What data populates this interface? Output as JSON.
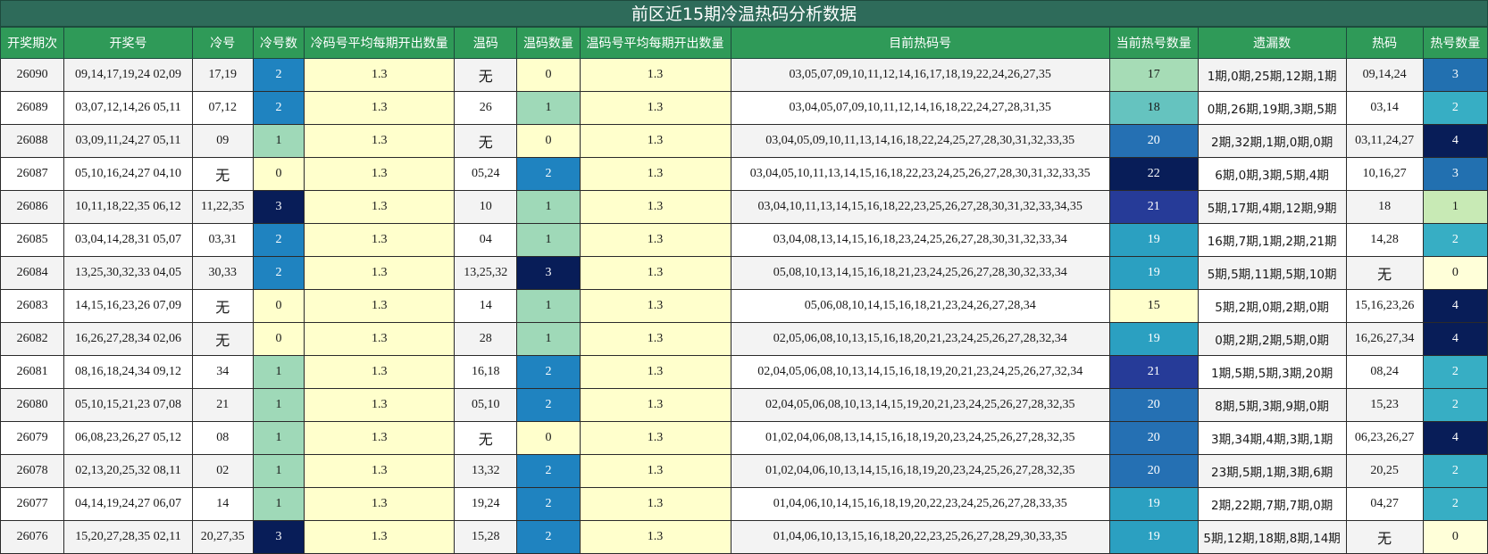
{
  "title": "前区近15期冷温热码分析数据",
  "headers": [
    "开奖期次",
    "开奖号",
    "冷号",
    "冷号数",
    "冷码号平均每期开出数量",
    "温码",
    "温码数量",
    "温码号平均每期开出数量",
    "目前热码号",
    "当前热号数量",
    "遗漏数",
    "热码",
    "热号数量"
  ],
  "colors": {
    "heatmap_0": "#ffffcc",
    "heatmap_1": "#9fd9b8",
    "heatmap_2": "#1f83c0",
    "heatmap_3": "#081d58",
    "hot_15": "#ffffcc",
    "hot_17": "#a6dcb6",
    "hot_18": "#65c3bf",
    "hot_19": "#2ba0c1",
    "hot_20": "#2570b3",
    "hot_21": "#263b98",
    "hot_22": "#081d58",
    "hotnum_0": "#ffffd9",
    "hotnum_1": "#c8eab5",
    "hotnum_2": "#37aec4",
    "hotnum_3": "#2270b0",
    "hotnum_4": "#081d58"
  },
  "rows": [
    {
      "period": "26090",
      "draw": "09,14,17,19,24 02,09",
      "cold": "17,19",
      "cold_count": "2",
      "cold_avg": "1.3",
      "warm": "无",
      "warm_count": "0",
      "warm_avg": "1.3",
      "hot_list": "03,05,07,09,10,11,12,14,16,17,18,19,22,24,26,27,35",
      "hot_count": "17",
      "miss": "1期,0期,25期,12期,1期",
      "hot": "09,14,24",
      "hot_num": "3"
    },
    {
      "period": "26089",
      "draw": "03,07,12,14,26 05,11",
      "cold": "07,12",
      "cold_count": "2",
      "cold_avg": "1.3",
      "warm": "26",
      "warm_count": "1",
      "warm_avg": "1.3",
      "hot_list": "03,04,05,07,09,10,11,12,14,16,18,22,24,27,28,31,35",
      "hot_count": "18",
      "miss": "0期,26期,19期,3期,5期",
      "hot": "03,14",
      "hot_num": "2"
    },
    {
      "period": "26088",
      "draw": "03,09,11,24,27 05,11",
      "cold": "09",
      "cold_count": "1",
      "cold_avg": "1.3",
      "warm": "无",
      "warm_count": "0",
      "warm_avg": "1.3",
      "hot_list": "03,04,05,09,10,11,13,14,16,18,22,24,25,27,28,30,31,32,33,35",
      "hot_count": "20",
      "miss": "2期,32期,1期,0期,0期",
      "hot": "03,11,24,27",
      "hot_num": "4"
    },
    {
      "period": "26087",
      "draw": "05,10,16,24,27 04,10",
      "cold": "无",
      "cold_count": "0",
      "cold_avg": "1.3",
      "warm": "05,24",
      "warm_count": "2",
      "warm_avg": "1.3",
      "hot_list": "03,04,05,10,11,13,14,15,16,18,22,23,24,25,26,27,28,30,31,32,33,35",
      "hot_count": "22",
      "miss": "6期,0期,3期,5期,4期",
      "hot": "10,16,27",
      "hot_num": "3"
    },
    {
      "period": "26086",
      "draw": "10,11,18,22,35 06,12",
      "cold": "11,22,35",
      "cold_count": "3",
      "cold_avg": "1.3",
      "warm": "10",
      "warm_count": "1",
      "warm_avg": "1.3",
      "hot_list": "03,04,10,11,13,14,15,16,18,22,23,25,26,27,28,30,31,32,33,34,35",
      "hot_count": "21",
      "miss": "5期,17期,4期,12期,9期",
      "hot": "18",
      "hot_num": "1"
    },
    {
      "period": "26085",
      "draw": "03,04,14,28,31 05,07",
      "cold": "03,31",
      "cold_count": "2",
      "cold_avg": "1.3",
      "warm": "04",
      "warm_count": "1",
      "warm_avg": "1.3",
      "hot_list": "03,04,08,13,14,15,16,18,23,24,25,26,27,28,30,31,32,33,34",
      "hot_count": "19",
      "miss": "16期,7期,1期,2期,21期",
      "hot": "14,28",
      "hot_num": "2"
    },
    {
      "period": "26084",
      "draw": "13,25,30,32,33 04,05",
      "cold": "30,33",
      "cold_count": "2",
      "cold_avg": "1.3",
      "warm": "13,25,32",
      "warm_count": "3",
      "warm_avg": "1.3",
      "hot_list": "05,08,10,13,14,15,16,18,21,23,24,25,26,27,28,30,32,33,34",
      "hot_count": "19",
      "miss": "5期,5期,11期,5期,10期",
      "hot": "无",
      "hot_num": "0"
    },
    {
      "period": "26083",
      "draw": "14,15,16,23,26 07,09",
      "cold": "无",
      "cold_count": "0",
      "cold_avg": "1.3",
      "warm": "14",
      "warm_count": "1",
      "warm_avg": "1.3",
      "hot_list": "05,06,08,10,14,15,16,18,21,23,24,26,27,28,34",
      "hot_count": "15",
      "miss": "5期,2期,0期,2期,0期",
      "hot": "15,16,23,26",
      "hot_num": "4"
    },
    {
      "period": "26082",
      "draw": "16,26,27,28,34 02,06",
      "cold": "无",
      "cold_count": "0",
      "cold_avg": "1.3",
      "warm": "28",
      "warm_count": "1",
      "warm_avg": "1.3",
      "hot_list": "02,05,06,08,10,13,15,16,18,20,21,23,24,25,26,27,28,32,34",
      "hot_count": "19",
      "miss": "0期,2期,2期,5期,0期",
      "hot": "16,26,27,34",
      "hot_num": "4"
    },
    {
      "period": "26081",
      "draw": "08,16,18,24,34 09,12",
      "cold": "34",
      "cold_count": "1",
      "cold_avg": "1.3",
      "warm": "16,18",
      "warm_count": "2",
      "warm_avg": "1.3",
      "hot_list": "02,04,05,06,08,10,13,14,15,16,18,19,20,21,23,24,25,26,27,32,34",
      "hot_count": "21",
      "miss": "1期,5期,5期,3期,20期",
      "hot": "08,24",
      "hot_num": "2"
    },
    {
      "period": "26080",
      "draw": "05,10,15,21,23 07,08",
      "cold": "21",
      "cold_count": "1",
      "cold_avg": "1.3",
      "warm": "05,10",
      "warm_count": "2",
      "warm_avg": "1.3",
      "hot_list": "02,04,05,06,08,10,13,14,15,19,20,21,23,24,25,26,27,28,32,35",
      "hot_count": "20",
      "miss": "8期,5期,3期,9期,0期",
      "hot": "15,23",
      "hot_num": "2"
    },
    {
      "period": "26079",
      "draw": "06,08,23,26,27 05,12",
      "cold": "08",
      "cold_count": "1",
      "cold_avg": "1.3",
      "warm": "无",
      "warm_count": "0",
      "warm_avg": "1.3",
      "hot_list": "01,02,04,06,08,13,14,15,16,18,19,20,23,24,25,26,27,28,32,35",
      "hot_count": "20",
      "miss": "3期,34期,4期,3期,1期",
      "hot": "06,23,26,27",
      "hot_num": "4"
    },
    {
      "period": "26078",
      "draw": "02,13,20,25,32 08,11",
      "cold": "02",
      "cold_count": "1",
      "cold_avg": "1.3",
      "warm": "13,32",
      "warm_count": "2",
      "warm_avg": "1.3",
      "hot_list": "01,02,04,06,10,13,14,15,16,18,19,20,23,24,25,26,27,28,32,35",
      "hot_count": "20",
      "miss": "23期,5期,1期,3期,6期",
      "hot": "20,25",
      "hot_num": "2"
    },
    {
      "period": "26077",
      "draw": "04,14,19,24,27 06,07",
      "cold": "14",
      "cold_count": "1",
      "cold_avg": "1.3",
      "warm": "19,24",
      "warm_count": "2",
      "warm_avg": "1.3",
      "hot_list": "01,04,06,10,14,15,16,18,19,20,22,23,24,25,26,27,28,33,35",
      "hot_count": "19",
      "miss": "2期,22期,7期,7期,0期",
      "hot": "04,27",
      "hot_num": "2"
    },
    {
      "period": "26076",
      "draw": "15,20,27,28,35 02,11",
      "cold": "20,27,35",
      "cold_count": "3",
      "cold_avg": "1.3",
      "warm": "15,28",
      "warm_count": "2",
      "warm_avg": "1.3",
      "hot_list": "01,04,06,10,13,15,16,18,20,22,23,25,26,27,28,29,30,33,35",
      "hot_count": "19",
      "miss": "5期,12期,18期,8期,14期",
      "hot": "无",
      "hot_num": "0"
    }
  ]
}
